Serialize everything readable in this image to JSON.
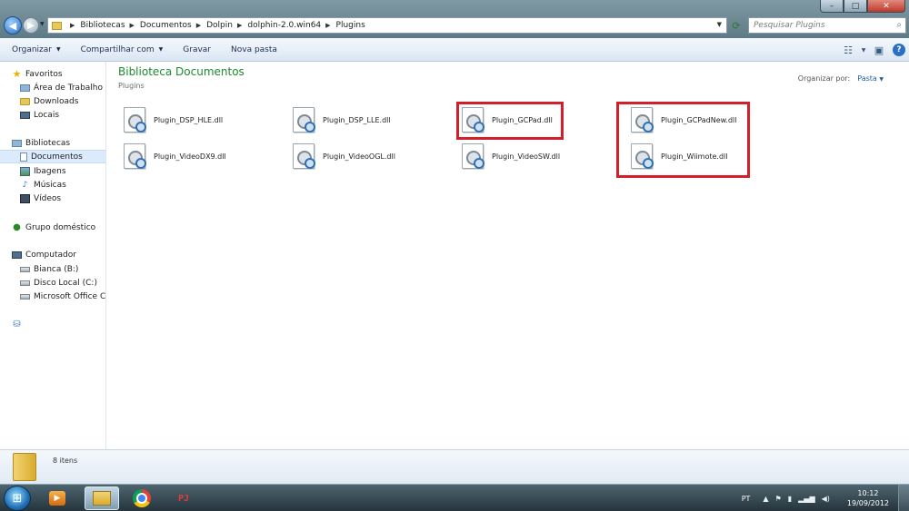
{
  "window": {
    "controls": {
      "minimize": "–",
      "maximize": "□",
      "close": "✕"
    }
  },
  "nav": {
    "back": "◀",
    "forward": "▶"
  },
  "address": {
    "crumbs": [
      "Bibliotecas",
      "Documentos",
      "Dolpin",
      "dolphin-2.0.win64",
      "Plugins"
    ]
  },
  "search": {
    "placeholder": "Pesquisar Plugins"
  },
  "toolbar": {
    "organize": "Organizar",
    "share": "Compartilhar com",
    "burn": "Gravar",
    "new_folder": "Nova pasta"
  },
  "sidebar": {
    "favorites": "Favoritos",
    "desktop": "Área de Trabalho",
    "downloads": "Downloads",
    "places": "Locais",
    "libraries": "Bibliotecas",
    "documents": "Documentos",
    "images": "Ibagens",
    "music": "Músicas",
    "videos": "Vídeos",
    "homegroup": "Grupo doméstico",
    "computer": "Computador",
    "drive_b": "Bianca (B:)",
    "drive_c": "Disco Local (C:)",
    "drive_office": "Microsoft Office Clic"
  },
  "content": {
    "title": "Biblioteca Documentos",
    "subtitle": "Plugins",
    "arrange_label": "Organizar por:",
    "arrange_value": "Pasta",
    "files": [
      "Plugin_DSP_HLE.dll",
      "Plugin_DSP_LLE.dll",
      "Plugin_GCPad.dll",
      "Plugin_GCPadNew.dll",
      "Plugin_VideoDX9.dll",
      "Plugin_VideoOGL.dll",
      "Plugin_VideoSW.dll",
      "Plugin_Wiimote.dll"
    ]
  },
  "details": {
    "count": "8 itens"
  },
  "taskbar": {
    "pj_label": "PJ",
    "lang": "PT",
    "time": "10:12",
    "date": "19/09/2012"
  },
  "colors": {
    "highlight": "#d2202a",
    "library_title": "#1e8a2e",
    "selection": "#dcebfc"
  }
}
